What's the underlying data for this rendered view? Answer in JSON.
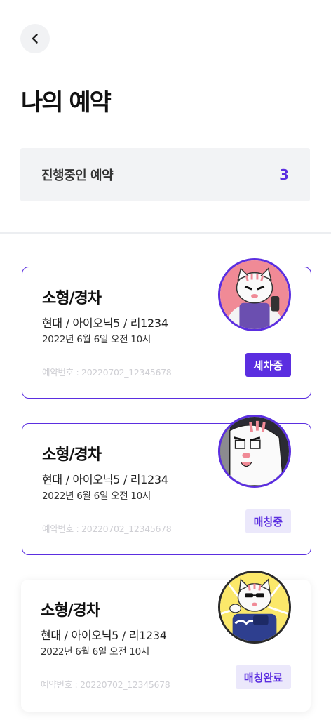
{
  "header": {
    "title": "나의 예약",
    "back_icon": "chevron-left-icon"
  },
  "summary": {
    "label": "진행중인 예약",
    "count": "3"
  },
  "reservations": [
    {
      "title": "소형/경차",
      "car": "현대 / 아이오닉5 / 리1234",
      "date": "2022년 6월 6일 오전 10시",
      "reservation_no": "예약번호 : 20220702_12345678",
      "status": "세차중",
      "avatar": "muscle-cat-avatar"
    },
    {
      "title": "소형/경차",
      "car": "현대 / 아이오닉5 / 리1234",
      "date": "2022년 6월 6일 오전 10시",
      "reservation_no": "예약번호 : 20220702_12345678",
      "status": "매칭중",
      "avatar": "peeking-cat-avatar"
    },
    {
      "title": "소형/경차",
      "car": "현대 / 아이오닉5 / 리1234",
      "date": "2022년 6월 6일 오전 10시",
      "reservation_no": "예약번호 : 20220702_12345678",
      "status": "매칭완료",
      "avatar": "washer-cat-avatar"
    }
  ],
  "colors": {
    "accent": "#5b2ee0",
    "accent_light": "#ebe8fb",
    "summary_bg": "#f2f3f5"
  }
}
